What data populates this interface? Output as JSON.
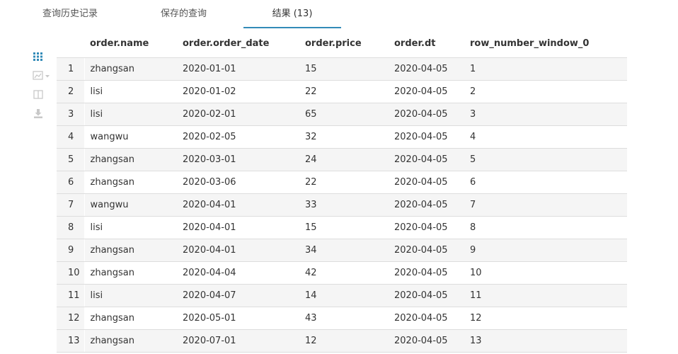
{
  "tabs": [
    {
      "label": "查询历史记录",
      "active": false
    },
    {
      "label": "保存的查询",
      "active": false
    },
    {
      "label": "结果 (13)",
      "active": true
    }
  ],
  "toolbar": {
    "icons": [
      "grid-icon",
      "chart-icon",
      "columns-icon",
      "download-icon"
    ]
  },
  "colors": {
    "accent": "#338bb8",
    "stripe": "#f5f5f5",
    "border": "#dddddd"
  },
  "table": {
    "headers": [
      "order.name",
      "order.order_date",
      "order.price",
      "order.dt",
      "row_number_window_0"
    ],
    "rows": [
      {
        "index": "1",
        "name": "zhangsan",
        "order_date": "2020-01-01",
        "price": "15",
        "dt": "2020-04-05",
        "rn": "1"
      },
      {
        "index": "2",
        "name": "lisi",
        "order_date": "2020-01-02",
        "price": "22",
        "dt": "2020-04-05",
        "rn": "2"
      },
      {
        "index": "3",
        "name": "lisi",
        "order_date": "2020-02-01",
        "price": "65",
        "dt": "2020-04-05",
        "rn": "3"
      },
      {
        "index": "4",
        "name": "wangwu",
        "order_date": "2020-02-05",
        "price": "32",
        "dt": "2020-04-05",
        "rn": "4"
      },
      {
        "index": "5",
        "name": "zhangsan",
        "order_date": "2020-03-01",
        "price": "24",
        "dt": "2020-04-05",
        "rn": "5"
      },
      {
        "index": "6",
        "name": "zhangsan",
        "order_date": "2020-03-06",
        "price": "22",
        "dt": "2020-04-05",
        "rn": "6"
      },
      {
        "index": "7",
        "name": "wangwu",
        "order_date": "2020-04-01",
        "price": "33",
        "dt": "2020-04-05",
        "rn": "7"
      },
      {
        "index": "8",
        "name": "lisi",
        "order_date": "2020-04-01",
        "price": "15",
        "dt": "2020-04-05",
        "rn": "8"
      },
      {
        "index": "9",
        "name": "zhangsan",
        "order_date": "2020-04-01",
        "price": "34",
        "dt": "2020-04-05",
        "rn": "9"
      },
      {
        "index": "10",
        "name": "zhangsan",
        "order_date": "2020-04-04",
        "price": "42",
        "dt": "2020-04-05",
        "rn": "10"
      },
      {
        "index": "11",
        "name": "lisi",
        "order_date": "2020-04-07",
        "price": "14",
        "dt": "2020-04-05",
        "rn": "11"
      },
      {
        "index": "12",
        "name": "zhangsan",
        "order_date": "2020-05-01",
        "price": "43",
        "dt": "2020-04-05",
        "rn": "12"
      },
      {
        "index": "13",
        "name": "zhangsan",
        "order_date": "2020-07-01",
        "price": "12",
        "dt": "2020-04-05",
        "rn": "13"
      }
    ]
  }
}
